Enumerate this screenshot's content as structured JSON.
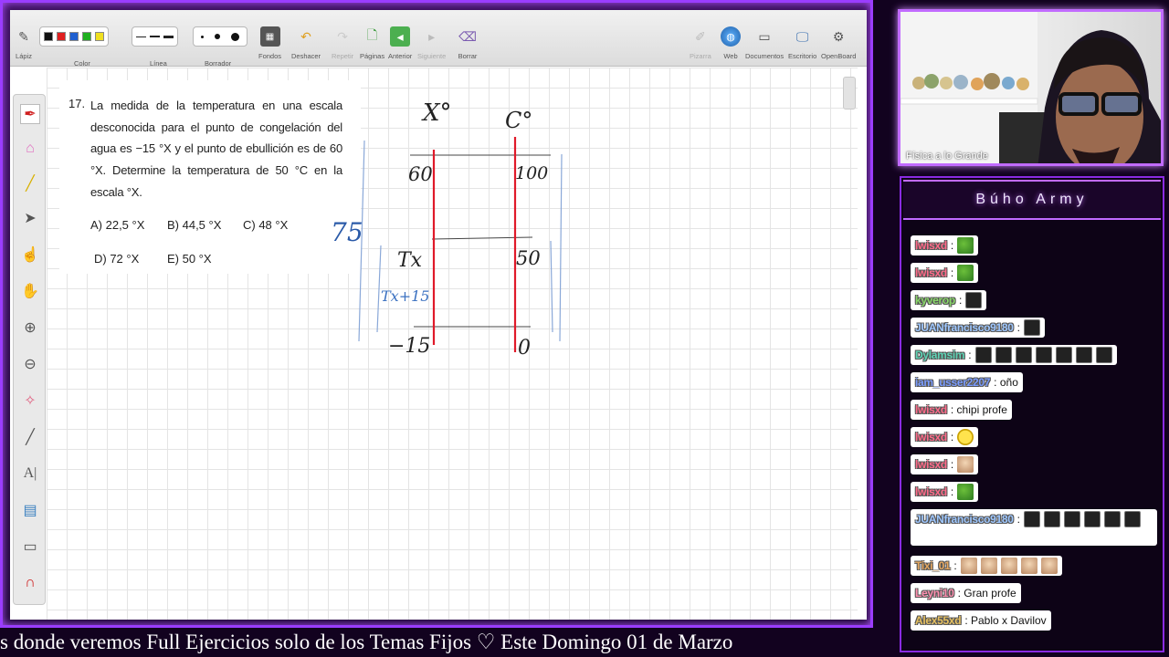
{
  "toolbar": {
    "items": [
      {
        "label": "Lápiz",
        "icon": "pen-icon"
      },
      {
        "label": "Color",
        "icon": "color-palette"
      },
      {
        "label": "Línea",
        "icon": "line-width"
      },
      {
        "label": "Borrador",
        "icon": "eraser-size"
      },
      {
        "label": "Fondos",
        "icon": "background-icon"
      },
      {
        "label": "Deshacer",
        "icon": "undo-icon"
      },
      {
        "label": "Repetir",
        "icon": "redo-icon"
      },
      {
        "label": "Páginas",
        "icon": "add-page-icon"
      },
      {
        "label": "Anterior",
        "icon": "previous-page-icon"
      },
      {
        "label": "Siguiente",
        "icon": "next-page-icon"
      },
      {
        "label": "Borrar",
        "icon": "erase-all-icon"
      },
      {
        "label": "Pizarra",
        "icon": "board-icon"
      },
      {
        "label": "Web",
        "icon": "globe-icon"
      },
      {
        "label": "Documentos",
        "icon": "folder-icon"
      },
      {
        "label": "Escritorio",
        "icon": "desktop-icon"
      },
      {
        "label": "OpenBoard",
        "icon": "settings-icon"
      }
    ],
    "colors": [
      "#111111",
      "#e02020",
      "#2060d0",
      "#20b020",
      "#f0e020"
    ]
  },
  "question": {
    "number": "17.",
    "text": "La medida de la temperatura en una escala desconocida para el punto de congelación del agua es −15 °X y el punto de ebullición es de 60 °X. Determine la temperatura de 50 °C en la escala °X.",
    "options": {
      "a": "A) 22,5 °X",
      "b": "B) 44,5 °X",
      "c": "C) 48 °X",
      "d": "D) 72 °X",
      "e": "E) 50 °X"
    }
  },
  "handwriting": {
    "scale_x": "X°",
    "scale_c": "C°",
    "x_top": "60",
    "c_top": "100",
    "x_mid": "Tx",
    "c_mid": "50",
    "x_bottom": "−15",
    "c_bottom": "0",
    "side_note": "75",
    "diff_note": "Tx+15"
  },
  "webcam": {
    "caption": "Física a lo Grande"
  },
  "chat": {
    "title": "Búho Army",
    "messages": [
      {
        "user": "lwisxd",
        "text": ":",
        "emotes": [
          "pepe"
        ]
      },
      {
        "user": "lwisxd",
        "text": ":",
        "emotes": [
          "pepe"
        ]
      },
      {
        "user": "kyverop",
        "text": ":",
        "emotes": [
          "dark"
        ]
      },
      {
        "user": "JUANfrancisco9180",
        "text": ":",
        "emotes": [
          "dark"
        ]
      },
      {
        "user": "Dylamsim",
        "text": ":",
        "emotes": [
          "dark",
          "dark",
          "dark",
          "dark",
          "dark",
          "dark",
          "dark"
        ]
      },
      {
        "user": "iam_usser2207",
        "text": ": oño",
        "emotes": []
      },
      {
        "user": "lwisxd",
        "text": ": chipi profe",
        "emotes": []
      },
      {
        "user": "lwisxd",
        "text": ":",
        "emotes": [
          "clock"
        ]
      },
      {
        "user": "lwisxd",
        "text": ":",
        "emotes": [
          "mug"
        ]
      },
      {
        "user": "lwisxd",
        "text": ":",
        "emotes": [
          "pepe"
        ]
      },
      {
        "user": "JUANfrancisco9180",
        "text": ":",
        "emotes": [
          "dark",
          "dark",
          "dark",
          "dark",
          "dark",
          "dark"
        ]
      },
      {
        "user": "Tixi_01",
        "text": ":",
        "emotes": [
          "mug",
          "mug",
          "mug",
          "mug",
          "mug"
        ]
      },
      {
        "user": "Leyni10",
        "text": ": Gran profe",
        "emotes": []
      },
      {
        "user": "Alex55xd",
        "text": ": Pablo x Davilov",
        "emotes": []
      }
    ]
  },
  "ticker": {
    "text": "s donde veremos Full Ejercicios solo de los Temas Fijos          ♡          Este Domingo 01 de Marzo"
  }
}
